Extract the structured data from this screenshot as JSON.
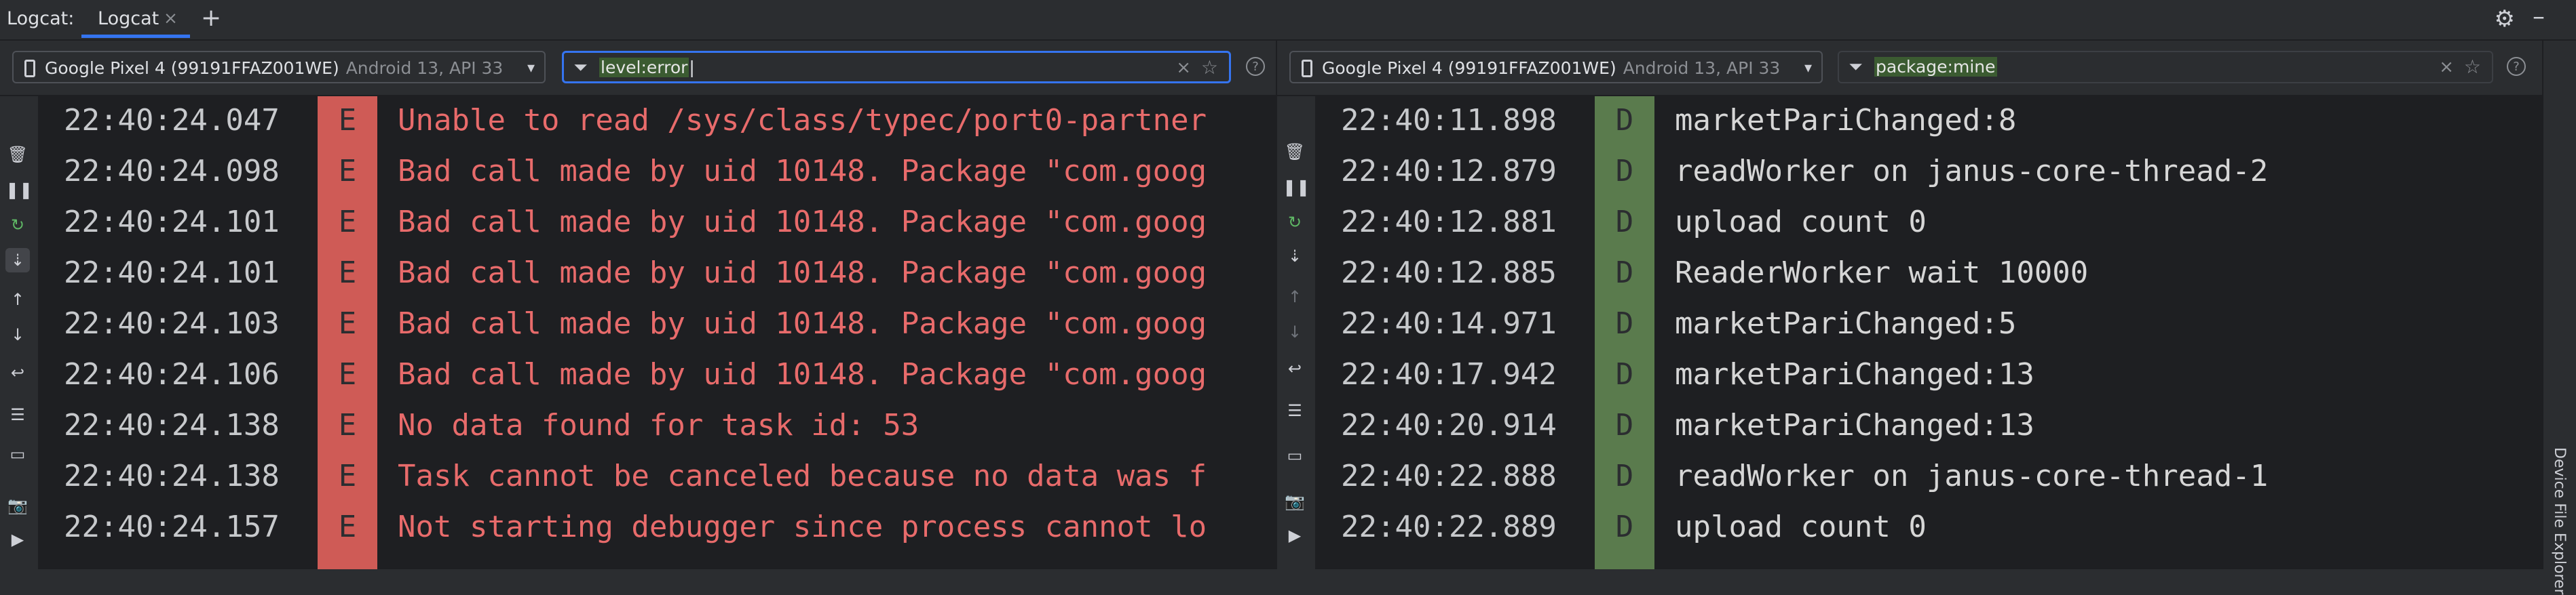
{
  "toolwindow": {
    "title": "Logcat:",
    "tab_label": "Logcat",
    "close_glyph": "×",
    "add_glyph": "+",
    "settings_icon": "gear-icon",
    "minimize_icon": "minimize-icon",
    "side_label": "Device File Explorer"
  },
  "left": {
    "device": {
      "name": "Google Pixel 4 (99191FFAZ001WE)",
      "api": "Android 13, API 33"
    },
    "filter": {
      "text": "level:error"
    },
    "rows": [
      {
        "ts": "22:40:24.047",
        "lvl": "E",
        "msg": "Unable to read /sys/class/typec/port0-partner"
      },
      {
        "ts": "22:40:24.098",
        "lvl": "E",
        "msg": "Bad call made by uid 10148. Package \"com.goog"
      },
      {
        "ts": "22:40:24.101",
        "lvl": "E",
        "msg": "Bad call made by uid 10148. Package \"com.goog"
      },
      {
        "ts": "22:40:24.101",
        "lvl": "E",
        "msg": "Bad call made by uid 10148. Package \"com.goog"
      },
      {
        "ts": "22:40:24.103",
        "lvl": "E",
        "msg": "Bad call made by uid 10148. Package \"com.goog"
      },
      {
        "ts": "22:40:24.106",
        "lvl": "E",
        "msg": "Bad call made by uid 10148. Package \"com.goog"
      },
      {
        "ts": "22:40:24.138",
        "lvl": "E",
        "msg": "No data found for task id: 53"
      },
      {
        "ts": "22:40:24.138",
        "lvl": "E",
        "msg": "Task cannot be canceled because no data was f"
      },
      {
        "ts": "22:40:24.157",
        "lvl": "E",
        "msg": "Not starting debugger since process cannot lo"
      }
    ]
  },
  "right": {
    "device": {
      "name": "Google Pixel 4 (99191FFAZ001WE)",
      "api": "Android 13, API 33"
    },
    "filter": {
      "text": "package:mine"
    },
    "rows": [
      {
        "ts": "22:40:11.898",
        "lvl": "D",
        "msg": "marketPariChanged:8"
      },
      {
        "ts": "22:40:12.879",
        "lvl": "D",
        "msg": "readWorker on janus-core-thread-2"
      },
      {
        "ts": "22:40:12.881",
        "lvl": "D",
        "msg": "upload count 0"
      },
      {
        "ts": "22:40:12.885",
        "lvl": "D",
        "msg": "ReaderWorker wait 10000"
      },
      {
        "ts": "22:40:14.971",
        "lvl": "D",
        "msg": "marketPariChanged:5"
      },
      {
        "ts": "22:40:17.942",
        "lvl": "D",
        "msg": "marketPariChanged:13"
      },
      {
        "ts": "22:40:20.914",
        "lvl": "D",
        "msg": "marketPariChanged:13"
      },
      {
        "ts": "22:40:22.888",
        "lvl": "D",
        "msg": "readWorker on janus-core-thread-1"
      },
      {
        "ts": "22:40:22.889",
        "lvl": "D",
        "msg": "upload count 0"
      }
    ]
  },
  "colors": {
    "error_column": "#cf5b56",
    "error_text": "#e86b6b",
    "debug_column": "#5a7b4d",
    "accent": "#3574f0",
    "filter_highlight": "#3b5b31"
  }
}
